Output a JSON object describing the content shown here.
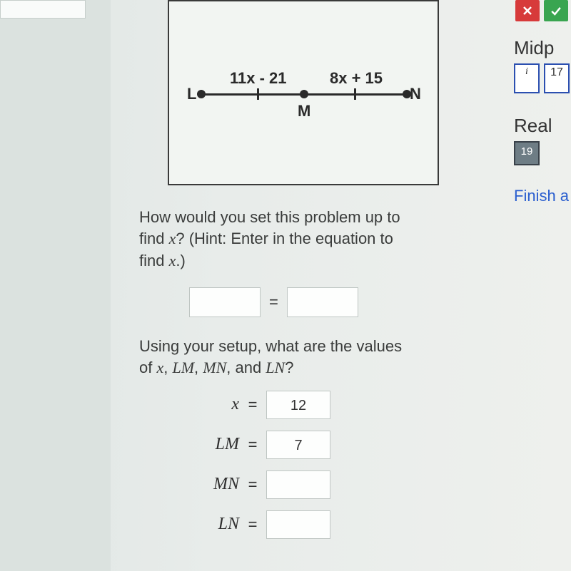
{
  "figure": {
    "point_left": "L",
    "point_mid": "M",
    "point_right": "N",
    "seg_left_expr": "11x - 21",
    "seg_right_expr": "8x + 15"
  },
  "question1": {
    "line1": "How would you set this problem up to",
    "line2_pre": "find ",
    "line2_var": "x",
    "line2_post": "? (Hint: Enter in the equation to",
    "line3_pre": "find ",
    "line3_var": "x",
    "line3_post": ".)"
  },
  "equation": {
    "lhs_value": "",
    "rhs_value": "",
    "eq": "="
  },
  "question2": {
    "line1": "Using your setup, what are the values",
    "line2_pre": "of ",
    "var_x": "x",
    "sep1": ", ",
    "var_lm": "LM",
    "sep2": ", ",
    "var_mn": "MN",
    "sep3": ", and ",
    "var_ln": "LN",
    "line2_post": "?"
  },
  "answers": {
    "x_label": "x",
    "x_value": "12",
    "lm_label": "LM",
    "lm_value": "7",
    "mn_label": "MN",
    "mn_value": "",
    "ln_label": "LN",
    "ln_value": "",
    "eq": "="
  },
  "sidebar": {
    "title1": "Midp",
    "tile_i": "i",
    "tile_17": "17",
    "title2": "Real",
    "tile_19": "19",
    "finish": "Finish a"
  }
}
